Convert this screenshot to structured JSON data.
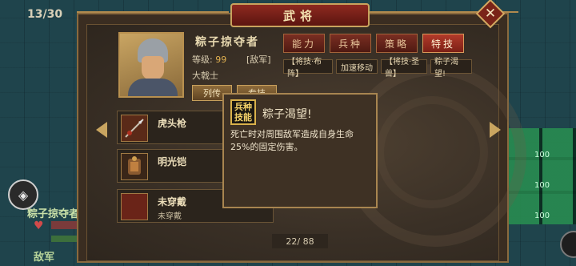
{
  "hud": {
    "turn": "13/30",
    "unit_name": "粽子掠夺者",
    "enemy_label": "敌军",
    "map_values": [
      "100",
      "100",
      "100"
    ]
  },
  "dialog": {
    "title": "武将",
    "close_label": "✕"
  },
  "general": {
    "name": "粽子掠夺者",
    "level_label": "等级:",
    "level_value": "99",
    "faction": "[敌军]",
    "rank": "大戟士",
    "sub_buttons": [
      "列传",
      "专技"
    ]
  },
  "tabs": [
    {
      "label": "能力",
      "active": false
    },
    {
      "label": "兵种",
      "active": false
    },
    {
      "label": "策略",
      "active": false
    },
    {
      "label": "特技",
      "active": true
    }
  ],
  "skills": [
    "【将技·布阵】",
    "加速移动",
    "【将技·圣兽】",
    "粽子渴望!"
  ],
  "equipment": [
    {
      "name": "虎头枪",
      "sub": ""
    },
    {
      "name": "明光铠",
      "sub": ""
    },
    {
      "name": "未穿戴",
      "sub": "未穿戴"
    }
  ],
  "pager": "22/ 88",
  "tooltip": {
    "badge_line1": "兵种",
    "badge_line2": "技能",
    "title": "粽子渴望!",
    "description": "死亡时对周围敌军造成自身生命25%的固定伤害。"
  },
  "colors": {
    "accent": "#b23a2a",
    "gold": "#c9a560"
  }
}
